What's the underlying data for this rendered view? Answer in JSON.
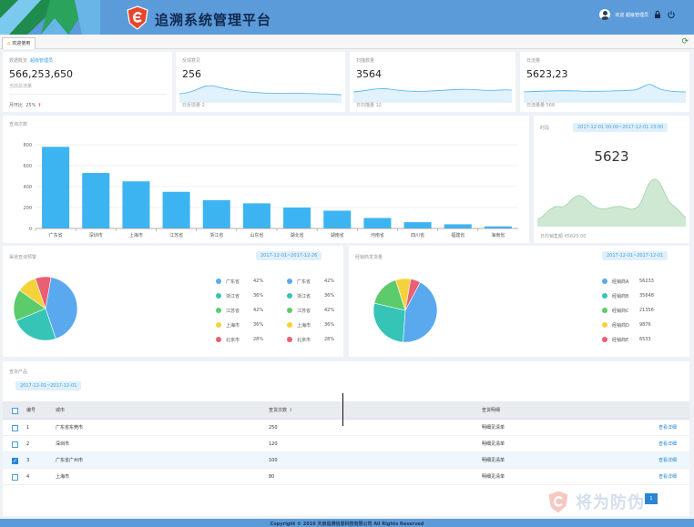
{
  "header": {
    "title": "追溯系统管理平台",
    "user_label": "欢迎 超级管理员"
  },
  "tabs": [
    {
      "label": "欢迎使用"
    }
  ],
  "stats": {
    "c1": {
      "label": "数据概览",
      "accent": "超级管理员",
      "value": "566,253,650",
      "sub": "当前总流量",
      "foot_label": "月环比",
      "foot_value": "25%"
    },
    "c2": {
      "label": "反馈意见",
      "value": "256",
      "foot": "日反馈量 2"
    },
    "c3": {
      "label": "扫描数量",
      "value": "3564",
      "foot": "日扫描量 12"
    },
    "c4": {
      "label": "日流量",
      "value": "5623,23",
      "foot": "日流量量 568"
    }
  },
  "bar_panel": {
    "title": "查询次数"
  },
  "right_panel": {
    "label": "时段",
    "date": "2017-12-01 00:00~2017-12-01 23:00",
    "value": "5623",
    "foot": "日均销售额 ¥5625.00"
  },
  "pie1": {
    "title": "渠道查询预警",
    "date": "2017-12-01~2017-12-26",
    "legend": [
      {
        "name": "广东省",
        "pct": "42%",
        "color": "#5aa9ee"
      },
      {
        "name": "浙江省",
        "pct": "36%",
        "color": "#36c4b6"
      },
      {
        "name": "江苏省",
        "pct": "42%",
        "color": "#5ccb6b"
      },
      {
        "name": "上海市",
        "pct": "36%",
        "color": "#f6d23a"
      },
      {
        "name": "北京市",
        "pct": "28%",
        "color": "#ea5f73"
      }
    ]
  },
  "pie2": {
    "title": "经销商发货量",
    "date": "2017-12-01~2017-12-01",
    "legend": [
      {
        "name": "经销商A",
        "value": "56233",
        "color": "#5aa9ee"
      },
      {
        "name": "经销商B",
        "value": "35648",
        "color": "#36c4b6"
      },
      {
        "name": "经销商C",
        "value": "21356",
        "color": "#5ccb6b"
      },
      {
        "name": "经销商D",
        "value": "9876",
        "color": "#f6d23a"
      },
      {
        "name": "经销商E",
        "value": "6533",
        "color": "#ea5f73"
      }
    ]
  },
  "products": {
    "title": "查货产品",
    "date": "2017-12-01~2017-12-01",
    "columns": [
      "编号",
      "城市",
      "查货次数",
      "查货明细"
    ],
    "rows": [
      {
        "id": "1",
        "city": "广东省东莞市",
        "count": "250",
        "detail": "明细见清单",
        "action": "查看详细",
        "checked": false
      },
      {
        "id": "2",
        "city": "深圳市",
        "count": "120",
        "detail": "明细见清单",
        "action": "查看详细",
        "checked": false
      },
      {
        "id": "3",
        "city": "广东省广州市",
        "count": "100",
        "detail": "明细见清单",
        "action": "查看详细",
        "checked": true
      },
      {
        "id": "4",
        "city": "上海市",
        "count": "80",
        "detail": "明细见清单",
        "action": "查看详细",
        "checked": false
      }
    ],
    "page": "1"
  },
  "footer": {
    "text": "Copyright © 2016 天启追溯信息科技有限公司 All Rights Reserved"
  },
  "watermark": {
    "text": "将为防伪"
  },
  "colors": {
    "header": "#5b9bd9",
    "accent": "#3aa0e8",
    "bar": "#3db4f2"
  },
  "chart_data": [
    {
      "type": "bar",
      "title": "查询次数",
      "categories": [
        "广东省",
        "深圳市",
        "上海市",
        "江苏省",
        "浙江省",
        "山东省",
        "湖北省",
        "湖南省",
        "河南省",
        "四川省",
        "福建省",
        "海南省"
      ],
      "values": [
        780,
        530,
        450,
        350,
        270,
        240,
        200,
        170,
        100,
        60,
        40,
        20
      ],
      "ylim": [
        0,
        800
      ],
      "yticks": [
        0,
        200,
        400,
        600,
        800
      ],
      "grid": true
    },
    {
      "type": "pie",
      "title": "渠道查询预警",
      "labels": [
        "广东省",
        "浙江省",
        "江苏省",
        "上海市",
        "北京市"
      ],
      "values": [
        42,
        24,
        16,
        10,
        8
      ]
    },
    {
      "type": "pie",
      "title": "经销商发货量",
      "labels": [
        "经销商A",
        "经销商B",
        "经销商C",
        "经销商D",
        "经销商E"
      ],
      "values": [
        56233,
        35648,
        21356,
        9876,
        6533
      ]
    }
  ]
}
